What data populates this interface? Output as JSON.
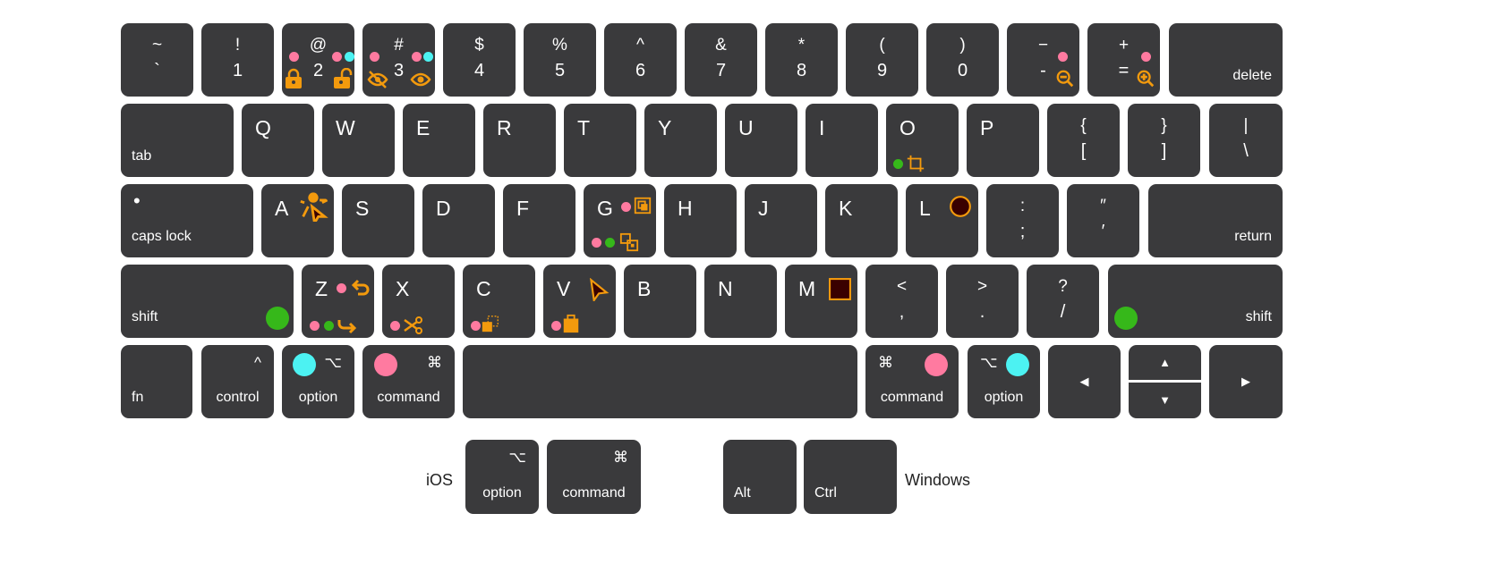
{
  "colors": {
    "key": "#3a3a3c",
    "pink": "#ff7aa0",
    "cyan": "#4cf2f2",
    "green": "#36b81a",
    "orange": "#f39a0d",
    "dark_fill": "#3a0000"
  },
  "rows": [
    {
      "keys": [
        {
          "id": "tilde",
          "top": "~",
          "bottom": "`"
        },
        {
          "id": "1",
          "top": "!",
          "bottom": "1"
        },
        {
          "id": "2",
          "top": "@",
          "bottom": "2"
        },
        {
          "id": "3",
          "top": "#",
          "bottom": "3"
        },
        {
          "id": "4",
          "top": "$",
          "bottom": "4"
        },
        {
          "id": "5",
          "top": "%",
          "bottom": "5"
        },
        {
          "id": "6",
          "top": "^",
          "bottom": "6"
        },
        {
          "id": "7",
          "top": "&",
          "bottom": "7"
        },
        {
          "id": "8",
          "top": "*",
          "bottom": "8"
        },
        {
          "id": "9",
          "top": "(",
          "bottom": "9"
        },
        {
          "id": "0",
          "top": ")",
          "bottom": "0"
        },
        {
          "id": "minus",
          "top": "−",
          "bottom": "-"
        },
        {
          "id": "equal",
          "top": "+",
          "bottom": "="
        },
        {
          "id": "delete",
          "label": "delete",
          "align": "right"
        }
      ]
    },
    {
      "keys": [
        {
          "id": "tab",
          "label": "tab",
          "align": "left"
        },
        {
          "id": "q",
          "letter": "Q"
        },
        {
          "id": "w",
          "letter": "W"
        },
        {
          "id": "e",
          "letter": "E"
        },
        {
          "id": "r",
          "letter": "R"
        },
        {
          "id": "t",
          "letter": "T"
        },
        {
          "id": "y",
          "letter": "Y"
        },
        {
          "id": "u",
          "letter": "U"
        },
        {
          "id": "i",
          "letter": "I"
        },
        {
          "id": "o",
          "letter": "O"
        },
        {
          "id": "p",
          "letter": "P"
        },
        {
          "id": "lbracket",
          "top": "{",
          "bottom": "["
        },
        {
          "id": "rbracket",
          "top": "}",
          "bottom": "]"
        },
        {
          "id": "backslash",
          "top": "|",
          "bottom": "\\"
        }
      ]
    },
    {
      "keys": [
        {
          "id": "capslock",
          "label": "caps lock",
          "align": "left",
          "symbol": "•",
          "symbol_align": "left"
        },
        {
          "id": "a",
          "letter": "A"
        },
        {
          "id": "s",
          "letter": "S"
        },
        {
          "id": "d",
          "letter": "D"
        },
        {
          "id": "f",
          "letter": "F"
        },
        {
          "id": "g",
          "letter": "G"
        },
        {
          "id": "h",
          "letter": "H"
        },
        {
          "id": "j",
          "letter": "J"
        },
        {
          "id": "k",
          "letter": "K"
        },
        {
          "id": "l",
          "letter": "L"
        },
        {
          "id": "semicolon",
          "top": ":",
          "bottom": ";"
        },
        {
          "id": "quote",
          "top": "″",
          "bottom": "′"
        },
        {
          "id": "return",
          "label": "return",
          "align": "right"
        }
      ]
    },
    {
      "keys": [
        {
          "id": "shift-left",
          "label": "shift",
          "align": "left"
        },
        {
          "id": "z",
          "letter": "Z"
        },
        {
          "id": "x",
          "letter": "X"
        },
        {
          "id": "c",
          "letter": "C"
        },
        {
          "id": "v",
          "letter": "V"
        },
        {
          "id": "b",
          "letter": "B"
        },
        {
          "id": "n",
          "letter": "N"
        },
        {
          "id": "m",
          "letter": "M"
        },
        {
          "id": "comma",
          "top": "<",
          "bottom": ","
        },
        {
          "id": "period",
          "top": ">",
          "bottom": "."
        },
        {
          "id": "slash",
          "top": "?",
          "bottom": "/"
        },
        {
          "id": "shift-right",
          "label": "shift",
          "align": "right"
        }
      ]
    },
    {
      "keys": [
        {
          "id": "fn",
          "label": "fn",
          "align": "left"
        },
        {
          "id": "control",
          "label": "control",
          "align": "center",
          "symbol": "^",
          "symbol_align": "right"
        },
        {
          "id": "option-left",
          "label": "option",
          "align": "center",
          "symbol": "⌥",
          "symbol_align": "right"
        },
        {
          "id": "command-left",
          "label": "command",
          "align": "center",
          "symbol": "⌘",
          "symbol_align": "right"
        },
        {
          "id": "space"
        },
        {
          "id": "command-right",
          "label": "command",
          "align": "center",
          "symbol": "⌘",
          "symbol_align": "left"
        },
        {
          "id": "option-right",
          "label": "option",
          "align": "center",
          "symbol": "⌥",
          "symbol_align": "left"
        },
        {
          "id": "arrow-left",
          "symbol": "◀"
        },
        {
          "id": "arrow-up",
          "symbol": "▲"
        },
        {
          "id": "arrow-down",
          "symbol": "▼"
        },
        {
          "id": "arrow-right",
          "symbol": "▶"
        }
      ]
    }
  ],
  "extra": {
    "ios_label": "iOS",
    "windows_label": "Windows",
    "keys": [
      {
        "id": "ios-option",
        "label": "option",
        "align": "center",
        "symbol": "⌥",
        "symbol_align": "right"
      },
      {
        "id": "ios-command",
        "label": "command",
        "align": "center",
        "symbol": "⌘",
        "symbol_align": "right"
      },
      {
        "id": "win-alt",
        "label": "Alt",
        "align": "left"
      },
      {
        "id": "win-ctrl",
        "label": "Ctrl",
        "align": "left"
      }
    ]
  },
  "icons": [
    "lock-closed",
    "lock-open",
    "eye-slash",
    "eye",
    "zoom-out",
    "zoom-in",
    "crop",
    "spotlight-cursor",
    "group",
    "ungroup",
    "ellipse",
    "undo",
    "redo",
    "scissors",
    "duplicate",
    "cursor",
    "paste",
    "rectangle"
  ]
}
